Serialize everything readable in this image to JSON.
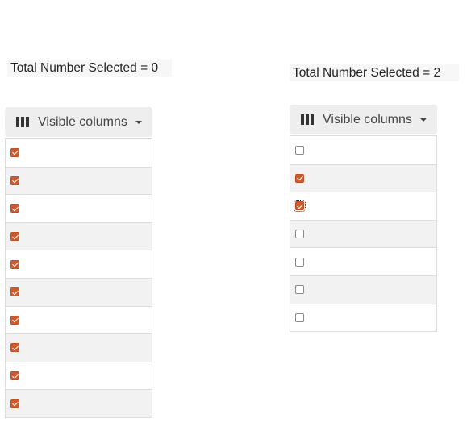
{
  "left_panel": {
    "total_label": "Total Number Selected = 0",
    "visible_columns_label": "Visible columns",
    "rows": [
      {
        "checked": true
      },
      {
        "checked": true
      },
      {
        "checked": true
      },
      {
        "checked": true
      },
      {
        "checked": true
      },
      {
        "checked": true
      },
      {
        "checked": true
      },
      {
        "checked": true
      },
      {
        "checked": true
      },
      {
        "checked": true
      }
    ]
  },
  "right_panel": {
    "total_label": "Total Number Selected = 2",
    "visible_columns_label": "Visible columns",
    "rows": [
      {
        "checked": false
      },
      {
        "checked": true
      },
      {
        "checked": true,
        "focused": true
      },
      {
        "checked": false
      },
      {
        "checked": false
      },
      {
        "checked": false
      },
      {
        "checked": false
      }
    ]
  },
  "colors": {
    "checkbox_checked": "#d05a2b",
    "row_alt": "#f2f2f2",
    "button_bg": "#eeeeee"
  },
  "icons": {
    "visible_columns": "columns-icon",
    "dropdown": "caret-down-icon"
  }
}
